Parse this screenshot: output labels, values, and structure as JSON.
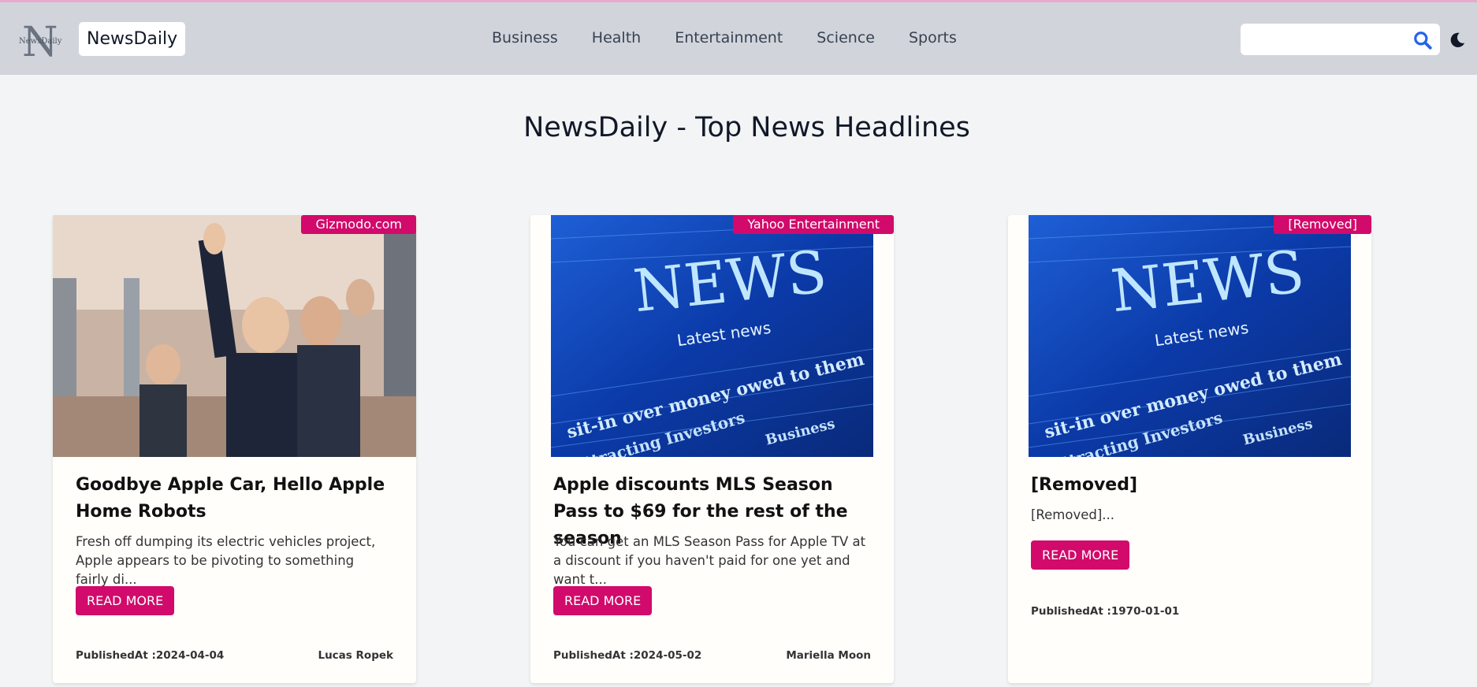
{
  "colors": {
    "accent": "#d10a6b",
    "header_bg": "#d1d5db",
    "page_bg": "#f2f4f5",
    "search_icon": "#2563eb"
  },
  "header": {
    "logo_letter": "N",
    "logo_text": "NewsDaily",
    "brand": "NewsDaily",
    "nav": [
      {
        "label": "Business"
      },
      {
        "label": "Health"
      },
      {
        "label": "Entertainment"
      },
      {
        "label": "Science"
      },
      {
        "label": "Sports"
      }
    ],
    "search": {
      "value": "",
      "placeholder": "",
      "icon": "search-icon"
    },
    "theme_toggle_icon": "moon-icon"
  },
  "main": {
    "title": "NewsDaily - Top News Headlines",
    "cards": [
      {
        "source": "Gizmodo.com",
        "image": "photo of man waving behind glass door",
        "title": "Goodbye Apple Car, Hello Apple Home Robots",
        "description": "Fresh off dumping its electric vehicles project, Apple appears to be pivoting to something fairly di...",
        "button": "READ MORE",
        "published": "PublishedAt :2024-04-04",
        "author": "Lucas Ropek"
      },
      {
        "source": "Yahoo Entertainment",
        "image": "blue news newspaper graphic",
        "image_words": {
          "main": "NEWS",
          "sub": "Latest news",
          "line": "sit-in over money owed to them",
          "line2": "Attracting Investors",
          "line3": "Business"
        },
        "title": "Apple discounts MLS Season Pass to $69 for the rest of the season",
        "description": "You can get an MLS Season Pass for Apple TV at a discount if you haven't paid for one yet and want t...",
        "button": "READ MORE",
        "published": "PublishedAt :2024-05-02",
        "author": "Mariella Moon"
      },
      {
        "source": "[Removed]",
        "image": "blue news newspaper graphic",
        "image_words": {
          "main": "NEWS",
          "sub": "Latest news",
          "line": "sit-in over money owed to them",
          "line2": "Attracting Investors",
          "line3": "Business"
        },
        "title": "[Removed]",
        "description": "[Removed]...",
        "button": "READ MORE",
        "published": "PublishedAt :1970-01-01",
        "author": ""
      }
    ]
  }
}
